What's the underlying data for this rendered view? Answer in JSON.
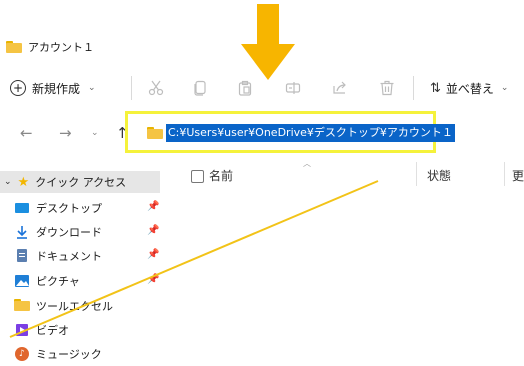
{
  "window": {
    "title": "アカウント１"
  },
  "toolbar": {
    "new_label": "新規作成",
    "new_chevron": "⌄",
    "sort_label": "並べ替え",
    "sort_chevron": "⌄",
    "icons": [
      "cut-icon",
      "copy-icon",
      "paste-icon",
      "rename-icon",
      "share-icon",
      "delete-icon"
    ]
  },
  "address": {
    "path": "C:¥Users¥user¥OneDrive¥デスクトップ¥アカウント１"
  },
  "columns": {
    "name": "名前",
    "status": "状態",
    "more": "更"
  },
  "sidebar": {
    "quick_access": "クイック アクセス",
    "items": [
      {
        "label": "デスクトップ",
        "pinned": true
      },
      {
        "label": "ダウンロード",
        "pinned": true
      },
      {
        "label": "ドキュメント",
        "pinned": true
      },
      {
        "label": "ピクチャ",
        "pinned": true
      },
      {
        "label": "ツールエクセル",
        "pinned": false
      },
      {
        "label": "ビデオ",
        "pinned": false
      },
      {
        "label": "ミュージック",
        "pinned": false
      }
    ]
  },
  "colors": {
    "highlight_border": "#f5f23b",
    "selection_bg": "#0a64c8",
    "arrow": "#f7b500",
    "overlay_line": "#f2c318"
  }
}
